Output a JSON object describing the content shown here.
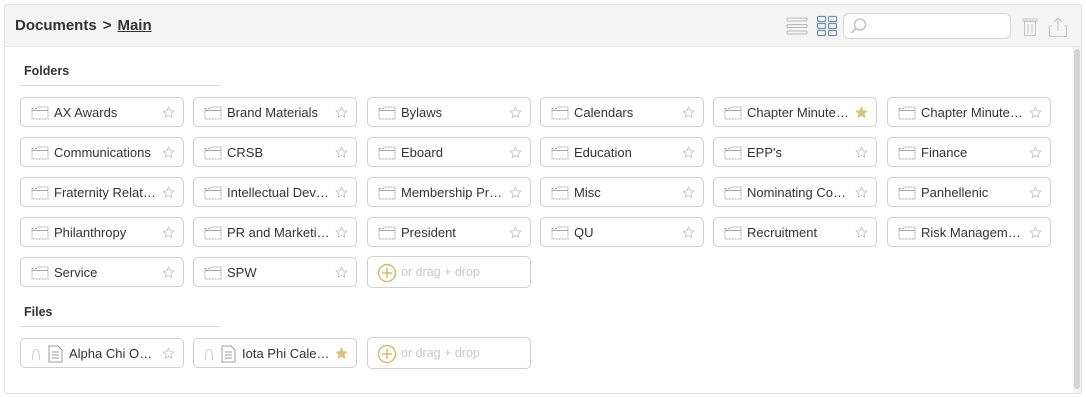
{
  "breadcrumb": {
    "root": "Documents",
    "separator": ">",
    "current": "Main"
  },
  "toolbar": {
    "list_view_icon": "list-view-icon",
    "grid_view_icon": "grid-view-icon",
    "search_placeholder": "",
    "search_value": "",
    "delete_icon": "trash-icon",
    "upload_icon": "upload-icon"
  },
  "sections": {
    "folders_title": "Folders",
    "files_title": "Files"
  },
  "colors": {
    "star_active": "#d9c27a",
    "star_inactive": "#c4c4c4",
    "add_accent": "#d6bd6a"
  },
  "folders": [
    {
      "label": "AX Awards",
      "starred": false
    },
    {
      "label": "Brand Materials",
      "starred": false
    },
    {
      "label": "Bylaws",
      "starred": false
    },
    {
      "label": "Calendars",
      "starred": false
    },
    {
      "label": "Chapter Minute…",
      "starred": true
    },
    {
      "label": "Chapter Minute…",
      "starred": false
    },
    {
      "label": "Communications",
      "starred": false
    },
    {
      "label": "CRSB",
      "starred": false
    },
    {
      "label": "Eboard",
      "starred": false
    },
    {
      "label": "Education",
      "starred": false
    },
    {
      "label": "EPP's",
      "starred": false
    },
    {
      "label": "Finance",
      "starred": false
    },
    {
      "label": "Fraternity Relati…",
      "starred": false
    },
    {
      "label": "Intellectual Dev…",
      "starred": false
    },
    {
      "label": "Membership Pro…",
      "starred": false
    },
    {
      "label": "Misc",
      "starred": false
    },
    {
      "label": "Nominating Co…",
      "starred": false
    },
    {
      "label": "Panhellenic",
      "starred": false
    },
    {
      "label": "Philanthropy",
      "starred": false
    },
    {
      "label": "PR and Marketing",
      "starred": false
    },
    {
      "label": "President",
      "starred": false
    },
    {
      "label": "QU",
      "starred": false
    },
    {
      "label": "Recruitment",
      "starred": false
    },
    {
      "label": "Risk Management",
      "starred": false
    },
    {
      "label": "Service",
      "starred": false
    },
    {
      "label": "SPW",
      "starred": false
    }
  ],
  "folder_add": {
    "label": "or drag + drop"
  },
  "files": [
    {
      "label": "Alpha Chi O…",
      "starred": false
    },
    {
      "label": "Iota Phi Cale…",
      "starred": true
    }
  ],
  "file_add": {
    "label": "or drag + drop"
  }
}
